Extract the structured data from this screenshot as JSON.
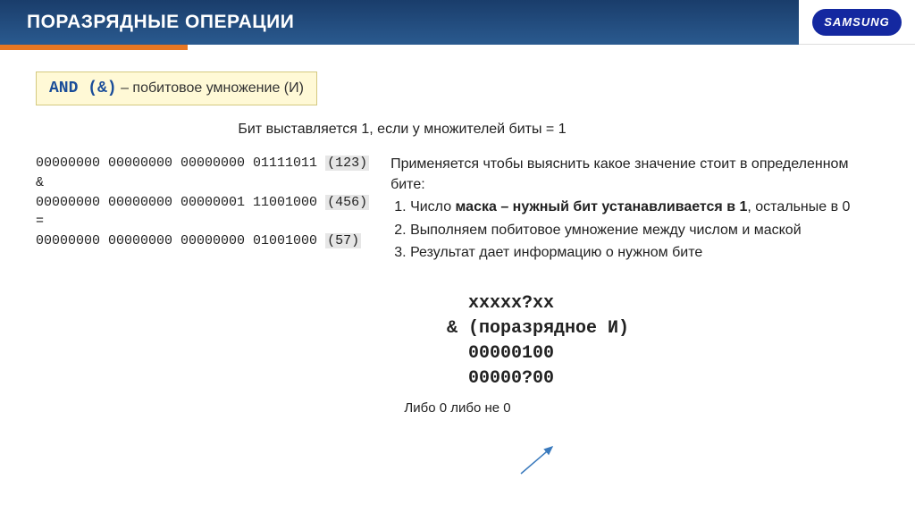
{
  "header": {
    "title": "ПОРАЗРЯДНЫЕ ОПЕРАЦИИ",
    "logo": "SAMSUNG"
  },
  "section": {
    "op_name": "AND (&)",
    "op_desc": " – побитовое умножение (И)",
    "subtitle": "Бит выставляется 1, если у множителей биты = 1"
  },
  "code": {
    "line1_bits": "00000000 00000000 00000000 01111011 ",
    "line1_val": "(123)",
    "line2": "&",
    "line3_bits": "00000000 00000000 00000001 11001000 ",
    "line3_val": "(456)",
    "line4": "=",
    "line5_bits": "00000000 00000000 00000000 01001000 ",
    "line5_val": "(57)"
  },
  "desc": {
    "intro": "Применяется чтобы выяснить какое значение стоит в определенном бите:",
    "item1_pre": "Число ",
    "item1_bold": "маска – нужный бит устанавливается в 1",
    "item1_post": ", остальные в 0",
    "item2": "Выполняем побитовое умножение между числом и маской",
    "item3": "Результат дает информацию о нужном бите"
  },
  "mono": {
    "l1": "  xxxxx?xx",
    "l2": "& (поразрядное И)",
    "l3": "  00000100",
    "l4": "  00000?00"
  },
  "footer": "Либо 0 либо не 0"
}
